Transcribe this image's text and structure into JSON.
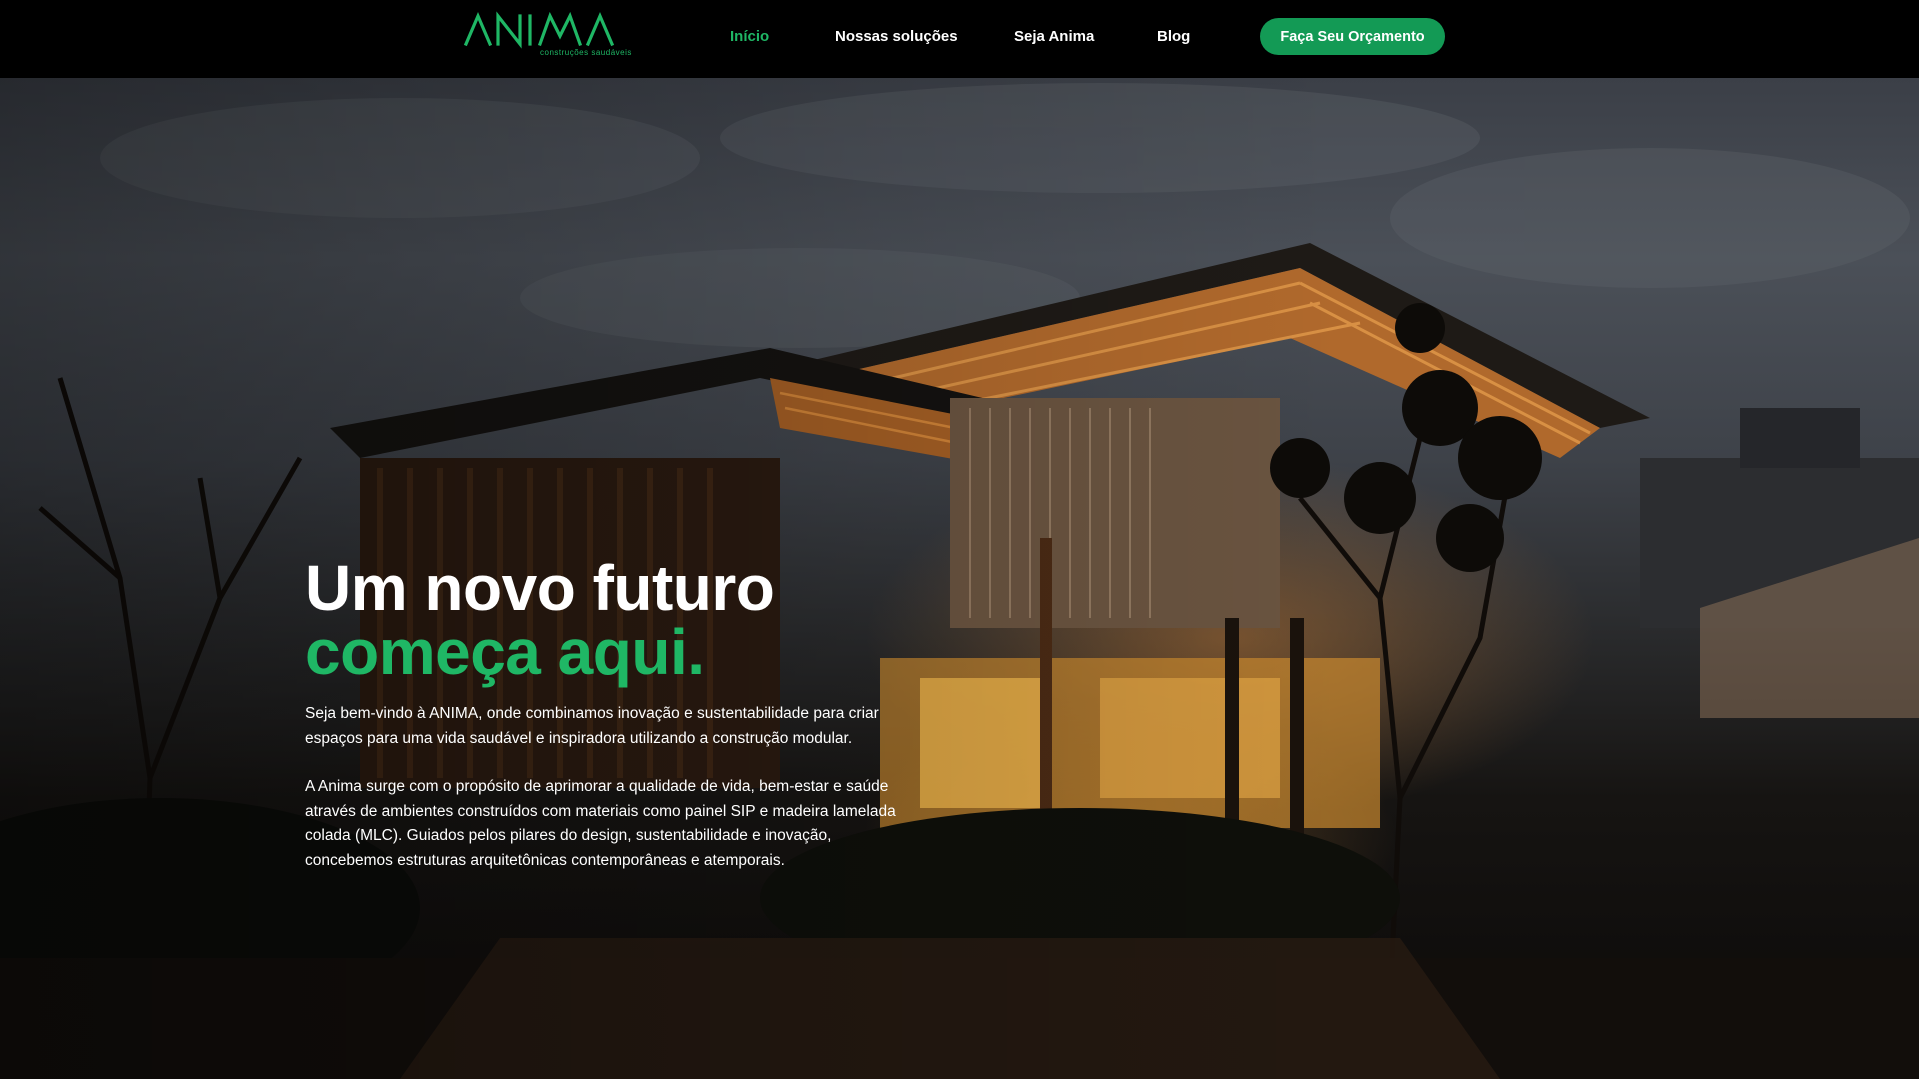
{
  "brand": {
    "name": "ANIMA",
    "tagline": "construções saudáveis",
    "accent_color": "#1fb765",
    "button_color": "#139a55"
  },
  "nav": {
    "items": [
      {
        "label": "Início",
        "active": true
      },
      {
        "label": "Nossas soluções",
        "active": false
      },
      {
        "label": "Seja Anima",
        "active": false
      },
      {
        "label": "Blog",
        "active": false
      }
    ],
    "cta_label": "Faça Seu Orçamento"
  },
  "hero": {
    "title_line1": "Um novo futuro",
    "title_line2": "começa aqui.",
    "paragraph1": "Seja bem-vindo à ANIMA, onde combinamos inovação e sustentabilidade para criar espaços para uma vida saudável e inspiradora utilizando a construção modular.",
    "paragraph2": "A Anima surge com o propósito de aprimorar a qualidade de vida, bem-estar e saúde através de ambientes construídos com materiais como painel SIP e madeira lamelada colada (MLC). Guiados pelos pilares do design, sustentabilidade e inovação, concebemos estruturas arquitetônicas contemporâneas e atemporais."
  }
}
